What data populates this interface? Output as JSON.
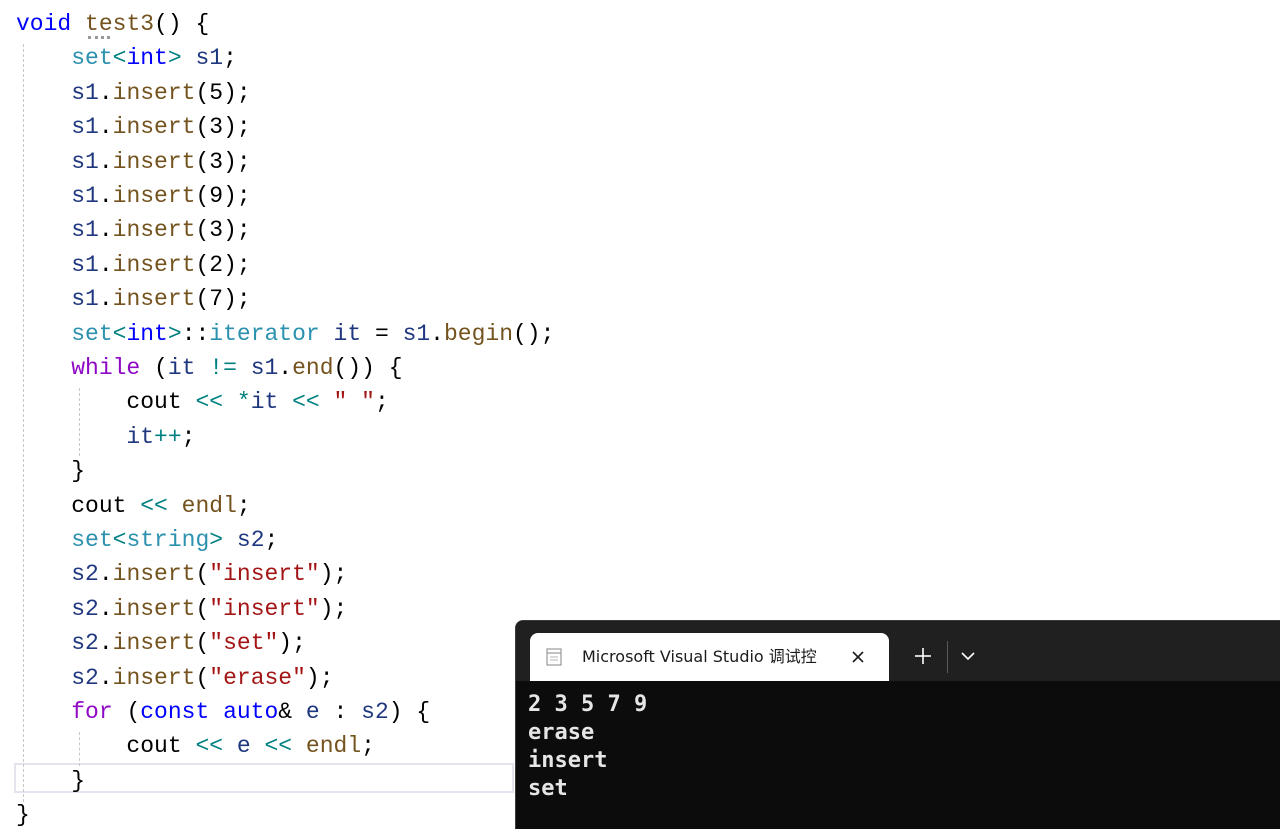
{
  "editor": {
    "lines": [
      {
        "tokens": [
          {
            "t": "void",
            "k": "kw"
          },
          {
            "t": " ",
            "k": "plain"
          },
          {
            "t": "test3",
            "k": "fn"
          },
          {
            "t": "() {",
            "k": "plain"
          }
        ]
      },
      {
        "tokens": [
          {
            "t": "    ",
            "k": "plain"
          },
          {
            "t": "set",
            "k": "type"
          },
          {
            "t": "<",
            "k": "op"
          },
          {
            "t": "int",
            "k": "kw"
          },
          {
            "t": ">",
            "k": "op"
          },
          {
            "t": " ",
            "k": "plain"
          },
          {
            "t": "s1",
            "k": "var"
          },
          {
            "t": ";",
            "k": "plain"
          }
        ]
      },
      {
        "tokens": [
          {
            "t": "    ",
            "k": "plain"
          },
          {
            "t": "s1",
            "k": "var"
          },
          {
            "t": ".",
            "k": "plain"
          },
          {
            "t": "insert",
            "k": "fn"
          },
          {
            "t": "(5);",
            "k": "plain"
          }
        ]
      },
      {
        "tokens": [
          {
            "t": "    ",
            "k": "plain"
          },
          {
            "t": "s1",
            "k": "var"
          },
          {
            "t": ".",
            "k": "plain"
          },
          {
            "t": "insert",
            "k": "fn"
          },
          {
            "t": "(3);",
            "k": "plain"
          }
        ]
      },
      {
        "tokens": [
          {
            "t": "    ",
            "k": "plain"
          },
          {
            "t": "s1",
            "k": "var"
          },
          {
            "t": ".",
            "k": "plain"
          },
          {
            "t": "insert",
            "k": "fn"
          },
          {
            "t": "(3);",
            "k": "plain"
          }
        ]
      },
      {
        "tokens": [
          {
            "t": "    ",
            "k": "plain"
          },
          {
            "t": "s1",
            "k": "var"
          },
          {
            "t": ".",
            "k": "plain"
          },
          {
            "t": "insert",
            "k": "fn"
          },
          {
            "t": "(9);",
            "k": "plain"
          }
        ]
      },
      {
        "tokens": [
          {
            "t": "    ",
            "k": "plain"
          },
          {
            "t": "s1",
            "k": "var"
          },
          {
            "t": ".",
            "k": "plain"
          },
          {
            "t": "insert",
            "k": "fn"
          },
          {
            "t": "(3);",
            "k": "plain"
          }
        ]
      },
      {
        "tokens": [
          {
            "t": "    ",
            "k": "plain"
          },
          {
            "t": "s1",
            "k": "var"
          },
          {
            "t": ".",
            "k": "plain"
          },
          {
            "t": "insert",
            "k": "fn"
          },
          {
            "t": "(2);",
            "k": "plain"
          }
        ]
      },
      {
        "tokens": [
          {
            "t": "    ",
            "k": "plain"
          },
          {
            "t": "s1",
            "k": "var"
          },
          {
            "t": ".",
            "k": "plain"
          },
          {
            "t": "insert",
            "k": "fn"
          },
          {
            "t": "(7);",
            "k": "plain"
          }
        ]
      },
      {
        "tokens": [
          {
            "t": "    ",
            "k": "plain"
          },
          {
            "t": "set",
            "k": "type"
          },
          {
            "t": "<",
            "k": "op"
          },
          {
            "t": "int",
            "k": "kw"
          },
          {
            "t": ">",
            "k": "op"
          },
          {
            "t": "::",
            "k": "plain"
          },
          {
            "t": "iterator",
            "k": "type"
          },
          {
            "t": " ",
            "k": "plain"
          },
          {
            "t": "it",
            "k": "var"
          },
          {
            "t": " = ",
            "k": "plain"
          },
          {
            "t": "s1",
            "k": "var"
          },
          {
            "t": ".",
            "k": "plain"
          },
          {
            "t": "begin",
            "k": "fn"
          },
          {
            "t": "();",
            "k": "plain"
          }
        ]
      },
      {
        "tokens": [
          {
            "t": "    ",
            "k": "plain"
          },
          {
            "t": "while",
            "k": "ctrl"
          },
          {
            "t": " (",
            "k": "plain"
          },
          {
            "t": "it",
            "k": "var"
          },
          {
            "t": " ",
            "k": "plain"
          },
          {
            "t": "!=",
            "k": "op"
          },
          {
            "t": " ",
            "k": "plain"
          },
          {
            "t": "s1",
            "k": "var"
          },
          {
            "t": ".",
            "k": "plain"
          },
          {
            "t": "end",
            "k": "fn"
          },
          {
            "t": "()) {",
            "k": "plain"
          }
        ]
      },
      {
        "tokens": [
          {
            "t": "        ",
            "k": "plain"
          },
          {
            "t": "cout",
            "k": "plain"
          },
          {
            "t": " ",
            "k": "plain"
          },
          {
            "t": "<<",
            "k": "op"
          },
          {
            "t": " ",
            "k": "plain"
          },
          {
            "t": "*",
            "k": "op"
          },
          {
            "t": "it",
            "k": "var"
          },
          {
            "t": " ",
            "k": "plain"
          },
          {
            "t": "<<",
            "k": "op"
          },
          {
            "t": " ",
            "k": "plain"
          },
          {
            "t": "\" \"",
            "k": "str"
          },
          {
            "t": ";",
            "k": "plain"
          }
        ]
      },
      {
        "tokens": [
          {
            "t": "        ",
            "k": "plain"
          },
          {
            "t": "it",
            "k": "var"
          },
          {
            "t": "++",
            "k": "op"
          },
          {
            "t": ";",
            "k": "plain"
          }
        ]
      },
      {
        "tokens": [
          {
            "t": "    ",
            "k": "plain"
          },
          {
            "t": "}",
            "k": "plain"
          }
        ]
      },
      {
        "tokens": [
          {
            "t": "    ",
            "k": "plain"
          },
          {
            "t": "cout",
            "k": "plain"
          },
          {
            "t": " ",
            "k": "plain"
          },
          {
            "t": "<<",
            "k": "op"
          },
          {
            "t": " ",
            "k": "plain"
          },
          {
            "t": "endl",
            "k": "fn"
          },
          {
            "t": ";",
            "k": "plain"
          }
        ]
      },
      {
        "tokens": [
          {
            "t": "    ",
            "k": "plain"
          },
          {
            "t": "set",
            "k": "type"
          },
          {
            "t": "<",
            "k": "op"
          },
          {
            "t": "string",
            "k": "type"
          },
          {
            "t": ">",
            "k": "op"
          },
          {
            "t": " ",
            "k": "plain"
          },
          {
            "t": "s2",
            "k": "var"
          },
          {
            "t": ";",
            "k": "plain"
          }
        ]
      },
      {
        "tokens": [
          {
            "t": "    ",
            "k": "plain"
          },
          {
            "t": "s2",
            "k": "var"
          },
          {
            "t": ".",
            "k": "plain"
          },
          {
            "t": "insert",
            "k": "fn"
          },
          {
            "t": "(",
            "k": "plain"
          },
          {
            "t": "\"insert\"",
            "k": "str"
          },
          {
            "t": ");",
            "k": "plain"
          }
        ]
      },
      {
        "tokens": [
          {
            "t": "    ",
            "k": "plain"
          },
          {
            "t": "s2",
            "k": "var"
          },
          {
            "t": ".",
            "k": "plain"
          },
          {
            "t": "insert",
            "k": "fn"
          },
          {
            "t": "(",
            "k": "plain"
          },
          {
            "t": "\"insert\"",
            "k": "str"
          },
          {
            "t": ");",
            "k": "plain"
          }
        ]
      },
      {
        "tokens": [
          {
            "t": "    ",
            "k": "plain"
          },
          {
            "t": "s2",
            "k": "var"
          },
          {
            "t": ".",
            "k": "plain"
          },
          {
            "t": "insert",
            "k": "fn"
          },
          {
            "t": "(",
            "k": "plain"
          },
          {
            "t": "\"set\"",
            "k": "str"
          },
          {
            "t": ");",
            "k": "plain"
          }
        ]
      },
      {
        "tokens": [
          {
            "t": "    ",
            "k": "plain"
          },
          {
            "t": "s2",
            "k": "var"
          },
          {
            "t": ".",
            "k": "plain"
          },
          {
            "t": "insert",
            "k": "fn"
          },
          {
            "t": "(",
            "k": "plain"
          },
          {
            "t": "\"erase\"",
            "k": "str"
          },
          {
            "t": ");",
            "k": "plain"
          }
        ]
      },
      {
        "tokens": [
          {
            "t": "    ",
            "k": "plain"
          },
          {
            "t": "for",
            "k": "ctrl"
          },
          {
            "t": " (",
            "k": "plain"
          },
          {
            "t": "const",
            "k": "kw"
          },
          {
            "t": " ",
            "k": "plain"
          },
          {
            "t": "auto",
            "k": "kw"
          },
          {
            "t": "&",
            "k": "plain"
          },
          {
            "t": " ",
            "k": "plain"
          },
          {
            "t": "e",
            "k": "var"
          },
          {
            "t": " : ",
            "k": "plain"
          },
          {
            "t": "s2",
            "k": "var"
          },
          {
            "t": ") {",
            "k": "plain"
          }
        ]
      },
      {
        "tokens": [
          {
            "t": "        ",
            "k": "plain"
          },
          {
            "t": "cout",
            "k": "plain"
          },
          {
            "t": " ",
            "k": "plain"
          },
          {
            "t": "<<",
            "k": "op"
          },
          {
            "t": " ",
            "k": "plain"
          },
          {
            "t": "e",
            "k": "var"
          },
          {
            "t": " ",
            "k": "plain"
          },
          {
            "t": "<<",
            "k": "op"
          },
          {
            "t": " ",
            "k": "plain"
          },
          {
            "t": "endl",
            "k": "fn"
          },
          {
            "t": ";",
            "k": "plain"
          }
        ]
      },
      {
        "tokens": [
          {
            "t": "    ",
            "k": "plain"
          },
          {
            "t": "}",
            "k": "plain"
          }
        ]
      },
      {
        "tokens": [
          {
            "t": "}",
            "k": "plain"
          }
        ]
      }
    ],
    "colors": {
      "kw": "#0000ff",
      "fn": "#74531f",
      "type": "#2b91af",
      "var": "#1f377f",
      "op": "#008080",
      "str": "#a31515",
      "ctrl": "#8f08c4",
      "plain": "#000000"
    }
  },
  "console": {
    "tab_title": "Microsoft Visual Studio 调试控",
    "tab_icon": "console-window-icon",
    "close_icon": "close-icon",
    "new_tab_icon": "plus-icon",
    "dropdown_icon": "chevron-down-icon",
    "output_lines": [
      "2 3 5 7 9",
      "erase",
      "insert",
      "set"
    ]
  }
}
